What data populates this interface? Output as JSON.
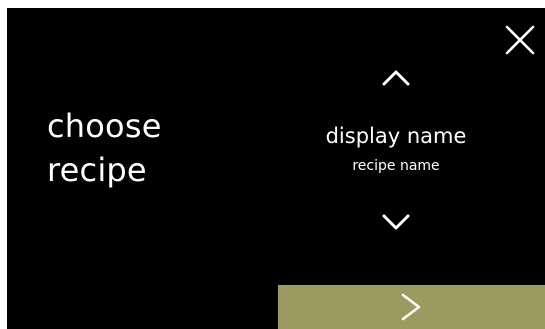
{
  "screen": {
    "title_line_1": "choose",
    "title_line_2": "recipe",
    "close_icon": "close-icon",
    "selector": {
      "up_icon": "chevron-up-icon",
      "display_name": "display name",
      "recipe_name": "recipe name",
      "down_icon": "chevron-down-icon"
    },
    "next_icon": "chevron-right-icon"
  },
  "colors": {
    "background": "#000000",
    "text": "#ffffff",
    "next_button": "#9a9a61"
  }
}
